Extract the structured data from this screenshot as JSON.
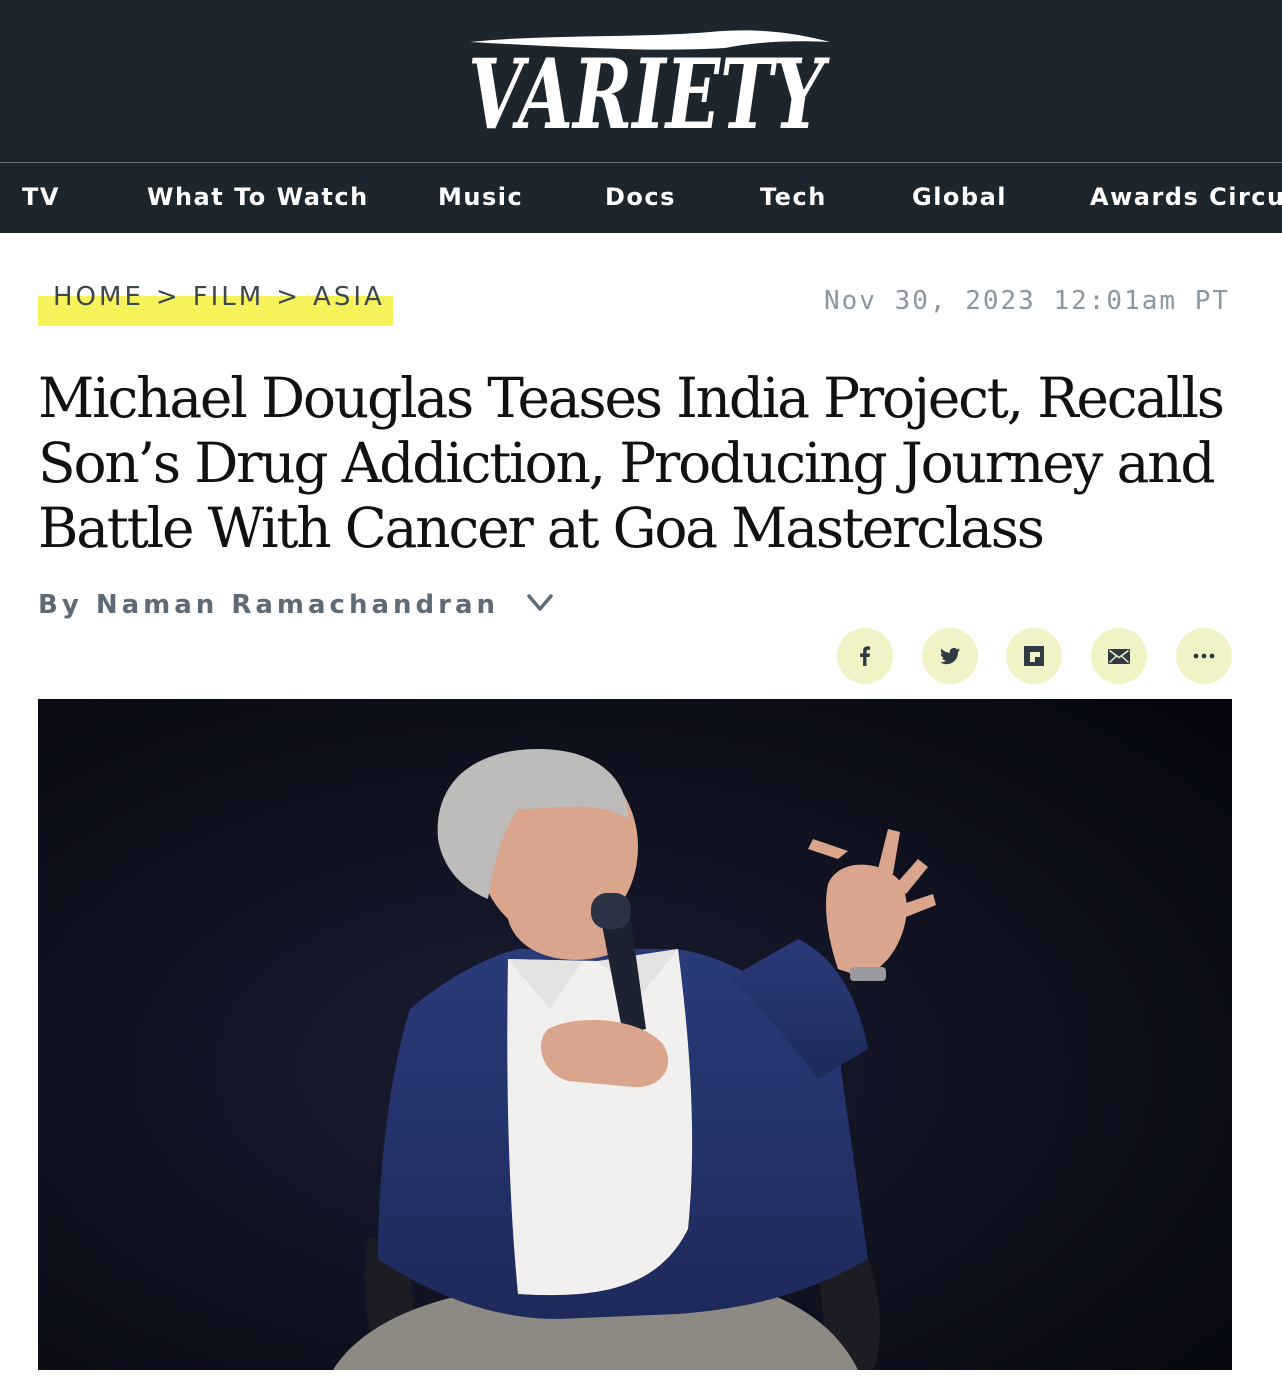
{
  "site": {
    "logo_text": "VARIETY"
  },
  "nav": {
    "items": [
      "TV",
      "What To Watch",
      "Music",
      "Docs",
      "Tech",
      "Global",
      "Awards Circuit"
    ]
  },
  "breadcrumb": {
    "items": [
      "HOME",
      "FILM",
      "ASIA"
    ],
    "separator": ">"
  },
  "article": {
    "date": "Nov 30, 2023 12:01am PT",
    "headline": "Michael Douglas Teases India Project, Recalls Son’s Drug Addiction, Producing Journey and Battle With Cancer at Goa Masterclass",
    "byline_prefix": "By",
    "author": "Naman Ramachandran"
  },
  "share": {
    "icons": [
      "facebook-icon",
      "twitter-icon",
      "flipboard-icon",
      "email-icon",
      "more-icon"
    ]
  },
  "colors": {
    "masthead_bg": "#1e262d",
    "breadcrumb_highlight": "#f6f259",
    "share_button_bg": "#eff3c5",
    "share_icon": "#2f3a44"
  }
}
